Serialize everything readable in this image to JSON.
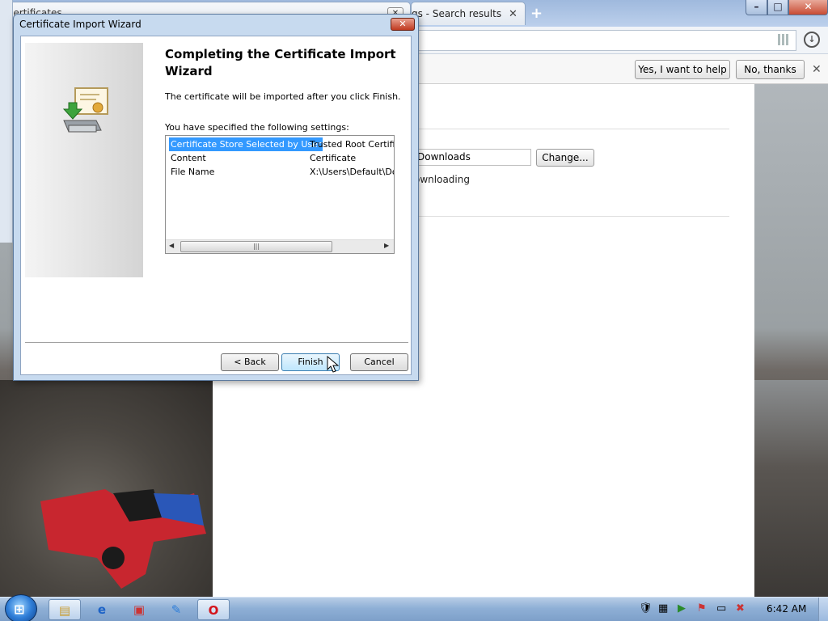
{
  "background_window": {
    "title": "Certificates",
    "partial_char": "I"
  },
  "browser": {
    "tabs": [
      {
        "label": "Certificates"
      },
      {
        "label": "gs - Search results"
      }
    ],
    "new_tab_symbol": "+",
    "window_buttons": {
      "minimize": "–",
      "maximize": "□",
      "close": "✕"
    },
    "infobar": {
      "yes_label": "Yes, I want to help",
      "no_label": "No, thanks",
      "close_symbol": "✕"
    },
    "page": {
      "download_location": "Downloads",
      "change_label": "Change...",
      "download_text": "ownloading"
    }
  },
  "dialog": {
    "title": "Certificate Import Wizard",
    "close_symbol": "✕",
    "heading": "Completing the Certificate Import Wizard",
    "description": "The certificate will be imported after you click Finish.",
    "settings_intro": "You have specified the following settings:",
    "settings": [
      {
        "name": "Certificate Store Selected by User",
        "value": "Trusted Root Certifica",
        "selected": true
      },
      {
        "name": "Content",
        "value": "Certificate",
        "selected": false
      },
      {
        "name": "File Name",
        "value": "X:\\Users\\Default\\Dow",
        "selected": false
      }
    ],
    "scroll_grip": "|||",
    "buttons": {
      "back": "< Back",
      "finish": "Finish",
      "cancel": "Cancel"
    }
  },
  "taskbar": {
    "start_symbol": "⊞",
    "items": [
      {
        "icon": "folder-icon",
        "glyph": "▤",
        "active": true
      },
      {
        "icon": "internet-explorer-icon",
        "glyph": "e",
        "active": false
      },
      {
        "icon": "media-icon",
        "glyph": "▣",
        "active": false
      },
      {
        "icon": "paint-icon",
        "glyph": "✎",
        "active": false
      },
      {
        "icon": "opera-icon",
        "glyph": "O",
        "active": true
      }
    ],
    "clock": "6:42 AM"
  },
  "colors": {
    "selection": "#3399ff",
    "taskbar": "#8fb0d6",
    "close_red": "#c84b33"
  }
}
